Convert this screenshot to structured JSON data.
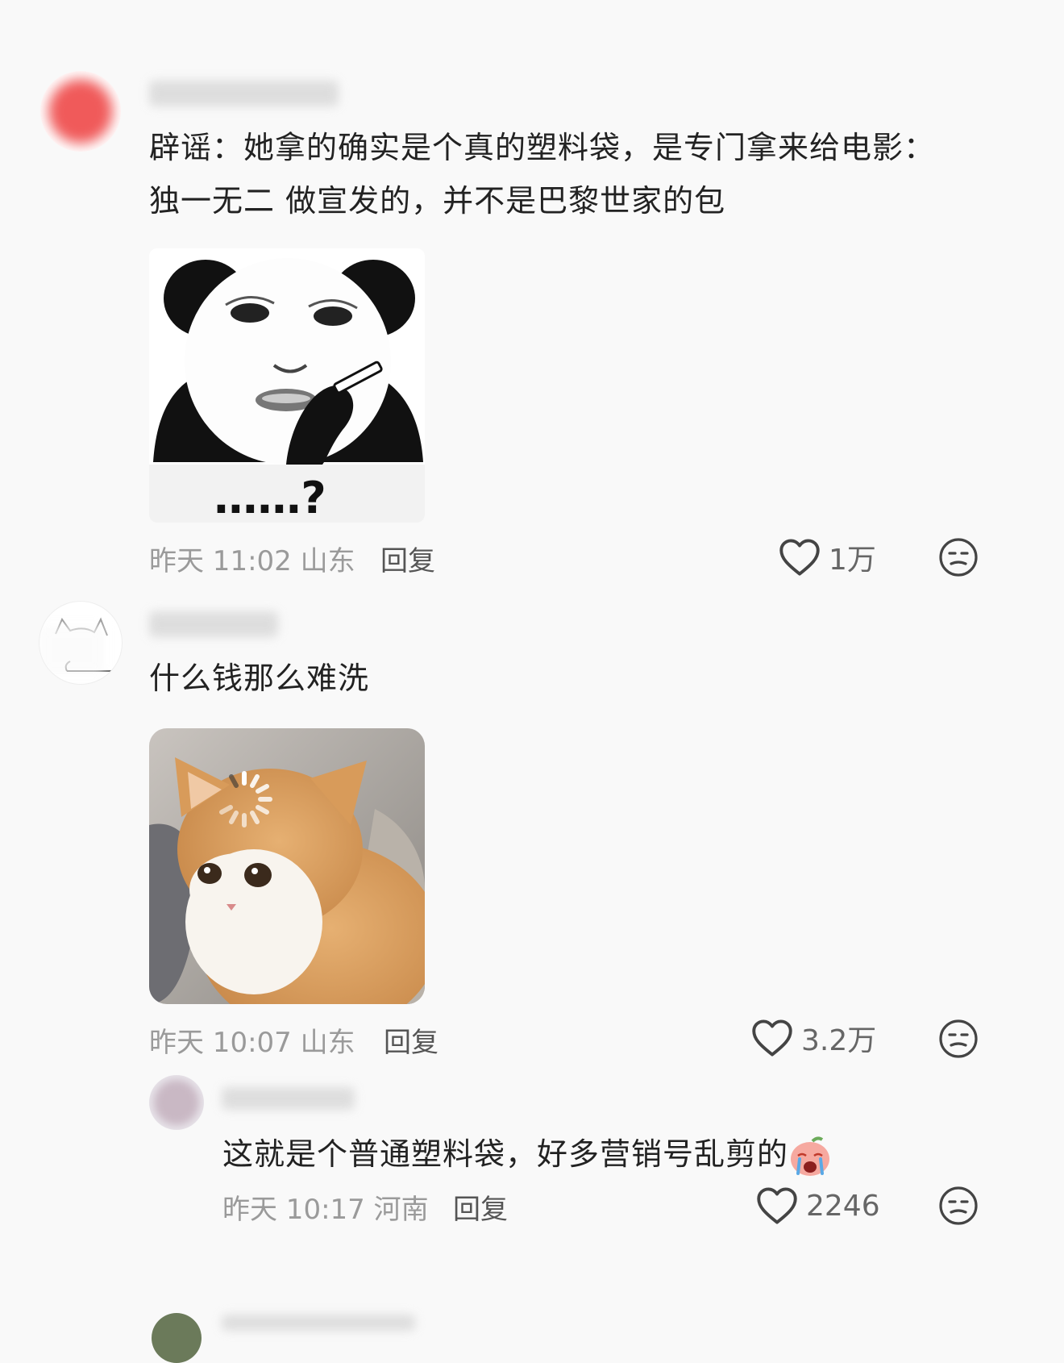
{
  "comments": [
    {
      "text_line1": "辟谣：她拿的确实是个真的塑料袋，是专门拿来给电影：",
      "text_line2": "独一无二 做宣发的，并不是巴黎世家的包",
      "sticker_caption": "……?",
      "time": "昨天 11:02",
      "location": "山东",
      "reply_label": "回复",
      "likes": "1万",
      "avatar_color": "#f05a5a"
    },
    {
      "text": "什么钱那么难洗",
      "time": "昨天 10:07",
      "location": "山东",
      "reply_label": "回复",
      "likes": "3.2万"
    },
    {
      "text": "这就是个普通塑料袋，好多营销号乱剪的",
      "time": "昨天 10:17",
      "location": "河南",
      "reply_label": "回复",
      "likes": "2246"
    }
  ],
  "icons": {
    "like": "heart-icon",
    "dislike": "meh-face-icon",
    "emoji": "crying-face-emoji"
  }
}
